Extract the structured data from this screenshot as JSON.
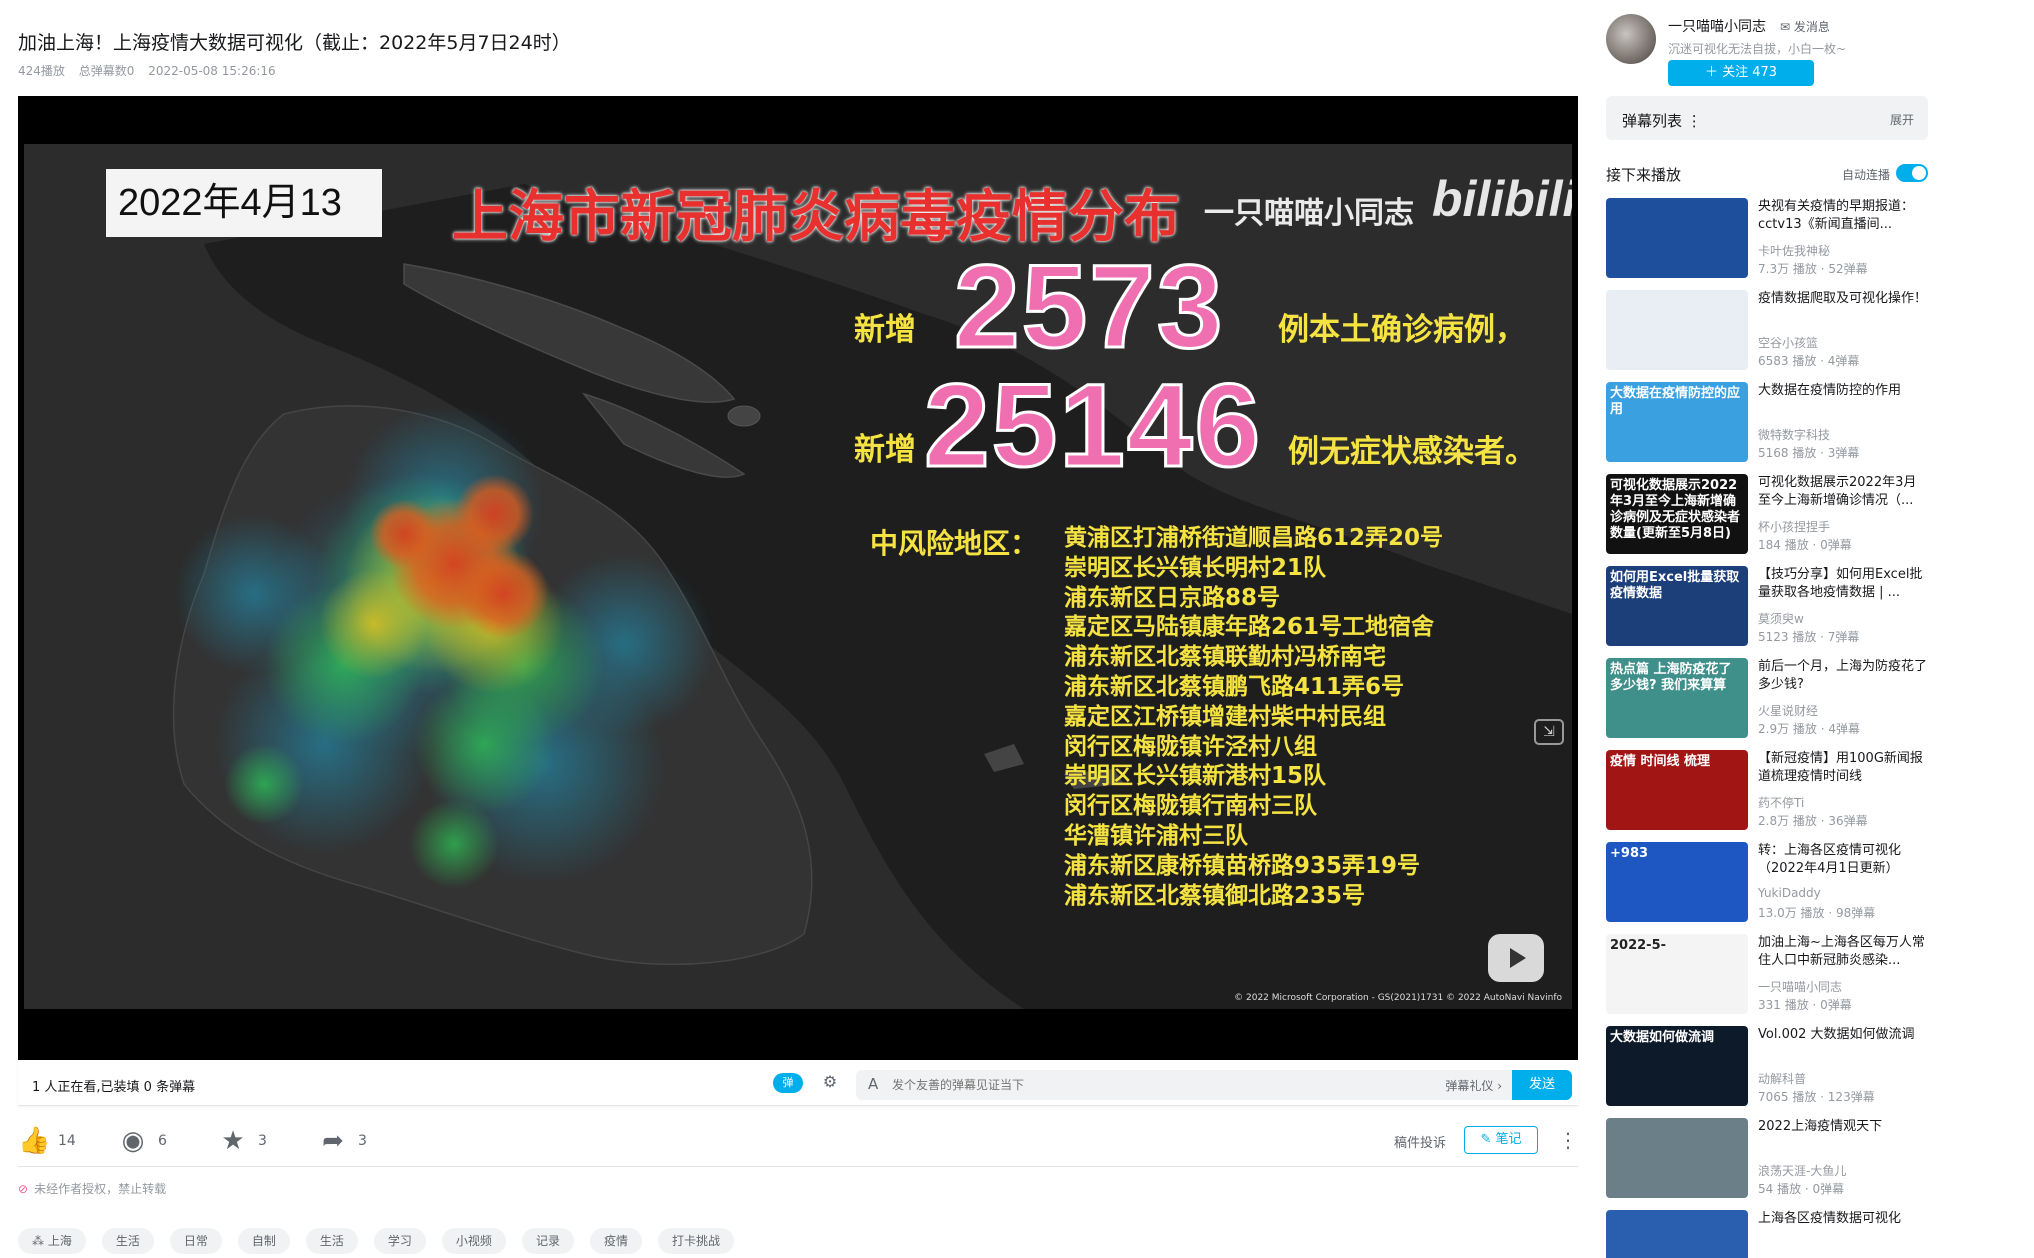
{
  "video": {
    "title": "加油上海！上海疫情大数据可视化（截止：2022年5月7日24时）",
    "plays": "424播放",
    "danmaku_total": "总弹幕数0",
    "datetime": "2022-05-08 15:26:16"
  },
  "frame": {
    "date": "2022年4月13",
    "title": "上海市新冠肺炎病毒疫情分布",
    "author_watermark": "一只喵喵小同志",
    "platform_watermark": "bilibili",
    "line1_prefix": "新增",
    "new_confirmed": "2573",
    "line1_suffix": "例本土确诊病例，",
    "line2_prefix": "新增",
    "new_asymptomatic": "25146",
    "line2_suffix": "例无症状感染者。",
    "risk_title": "中风险地区：",
    "risk_areas": [
      "黄浦区打浦桥街道顺昌路612弄20号",
      "崇明区长兴镇长明村21队",
      "浦东新区日京路88号",
      "嘉定区马陆镇康年路261号工地宿舍",
      "浦东新区北蔡镇联勤村冯桥南宅",
      "浦东新区北蔡镇鹏飞路411弄6号",
      "嘉定区江桥镇增建村柴中村民组",
      "闵行区梅陇镇许泾村八组",
      "崇明区长兴镇新港村15队",
      "闵行区梅陇镇行南村三队",
      "华漕镇许浦村三队",
      "浦东新区康桥镇苗桥路935弄19号",
      "浦东新区北蔡镇御北路235号"
    ],
    "copyright": "© 2022 Microsoft Corporation - GS(2021)1731  © 2022 AutoNavi  Navinfo"
  },
  "danmaku_bar": {
    "watching": "1 人正在看,已装填 0 条弹幕",
    "toggle_label": "弹",
    "input_placeholder": "发个友善的弹幕见证当下",
    "etiquette": "弹幕礼仪 ›",
    "send": "发送"
  },
  "toolbar": {
    "like_count": "14",
    "coin_count": "6",
    "fav_count": "3",
    "share_count": "3",
    "report": "稿件投诉",
    "note": "笔记"
  },
  "notice": "未经作者授权，禁止转载",
  "tags": [
    "上海",
    "生活",
    "日常",
    "自制",
    "生活",
    "学习",
    "小视频",
    "记录",
    "疫情",
    "打卡挑战"
  ],
  "uploader": {
    "name": "一只喵喵小同志",
    "message": "发消息",
    "signature": "沉迷可视化无法自拔，小白一枚~",
    "follow": "＋ 关注 473"
  },
  "danmaku_list": {
    "title": "弹幕列表",
    "expand": "展开"
  },
  "next_up": {
    "title": "接下来播放",
    "autoplay": "自动连播"
  },
  "recommendations": [
    {
      "title": "央视有关疫情的早期报道：cctv13《新闻直播间...",
      "author": "卡叶佐我神秘",
      "stats": "7.3万 播放 · 52弹幕",
      "thumb_text": "",
      "thumb_color": "#1d4f9c"
    },
    {
      "title": "疫情数据爬取及可视化操作！",
      "author": "空谷小孩篮",
      "stats": "6583 播放 · 4弹幕",
      "thumb_text": "",
      "thumb_color": "#e9eef4"
    },
    {
      "title": "大数据在疫情防控的作用",
      "author": "微特数字科技",
      "stats": "5168 播放 · 3弹幕",
      "thumb_text": "大数据在疫情防控的应用",
      "thumb_color": "#3aa0e0"
    },
    {
      "title": "可视化数据展示2022年3月至今上海新增确诊情况（...",
      "author": "杯小孩捏捏手",
      "stats": "184 播放 · 0弹幕",
      "thumb_text": "可视化数据展示2022年3月至今上海新增确诊病例及无症状感染者数量(更新至5月8日)",
      "thumb_color": "#111111"
    },
    {
      "title": "【技巧分享】如何用Excel批量获取各地疫情数据 | ...",
      "author": "莫须臾w",
      "stats": "5123 播放 · 7弹幕",
      "thumb_text": "如何用Excel批量获取疫情数据",
      "thumb_color": "#1c3f7a"
    },
    {
      "title": "前后一个月，上海为防疫花了多少钱?",
      "author": "火星说财经",
      "stats": "2.9万 播放 · 4弹幕",
      "thumb_text": "热点篇 上海防疫花了多少钱? 我们来算算",
      "thumb_color": "#3f8f8a"
    },
    {
      "title": "【新冠疫情】用100G新闻报道梳理疫情时间线",
      "author": "药不停Ti",
      "stats": "2.8万 播放 · 36弹幕",
      "thumb_text": "疫情 时间线 梳理",
      "thumb_color": "#a11515"
    },
    {
      "title": "转：上海各区疫情可视化（2022年4月1日更新）",
      "author": "YukiDaddy",
      "stats": "13.0万 播放 · 98弹幕",
      "thumb_text": "+983",
      "thumb_color": "#1f57c2"
    },
    {
      "title": "加油上海~上海各区每万人常住人口中新冠肺炎感染...",
      "author": "一只喵喵小同志",
      "stats": "331 播放 · 0弹幕",
      "thumb_text": "2022-5-",
      "thumb_color": "#f4f4f4"
    },
    {
      "title": "Vol.002 大数据如何做流调",
      "author": "动解科普",
      "stats": "7065 播放 · 123弹幕",
      "thumb_text": "大数据如何做流调",
      "thumb_color": "#0d1a2a"
    },
    {
      "title": "2022上海疫情观天下",
      "author": "浪荡天涯-大鱼儿",
      "stats": "54 播放 · 0弹幕",
      "thumb_text": "",
      "thumb_color": "#6b7f88"
    },
    {
      "title": "上海各区疫情数据可视化",
      "author": "",
      "stats": "",
      "thumb_text": "",
      "thumb_color": "#2a5fb0"
    }
  ]
}
